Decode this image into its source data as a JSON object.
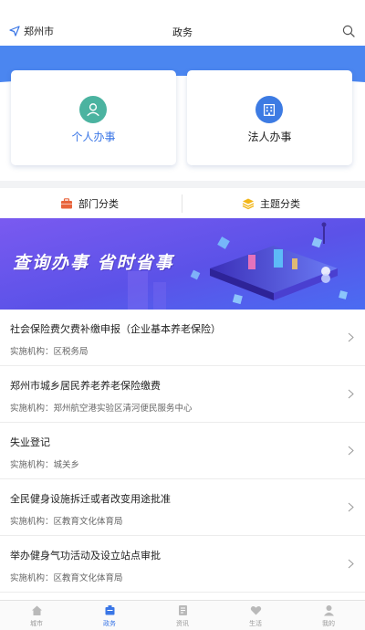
{
  "header": {
    "location": "郑州市",
    "title": "政务"
  },
  "cards": [
    {
      "label": "个人办事",
      "color": "#3a76e6",
      "icon_color": "#4bb3a0"
    },
    {
      "label": "法人办事",
      "color": "#222222",
      "icon_color": "#3d7be3"
    }
  ],
  "categories": [
    {
      "label": "部门分类"
    },
    {
      "label": "主题分类"
    }
  ],
  "banner": {
    "text": "查询办事  省时省事"
  },
  "services": [
    {
      "name": "社会保险费欠费补缴申报（企业基本养老保险）",
      "agency": "实施机构：区税务局"
    },
    {
      "name": "郑州市城乡居民养老养老保险缴费",
      "agency": "实施机构：郑州航空港实验区清河便民服务中心"
    },
    {
      "name": "失业登记",
      "agency": "实施机构：城关乡"
    },
    {
      "name": "全民健身设施拆迁或者改变用途批准",
      "agency": "实施机构：区教育文化体育局"
    },
    {
      "name": "举办健身气功活动及设立站点审批",
      "agency": "实施机构：区教育文化体育局"
    }
  ],
  "tabs": [
    {
      "label": "城市",
      "icon": "home-icon"
    },
    {
      "label": "政务",
      "icon": "government-icon"
    },
    {
      "label": "资讯",
      "icon": "news-icon"
    },
    {
      "label": "生活",
      "icon": "heart-icon"
    },
    {
      "label": "我的",
      "icon": "user-icon"
    }
  ],
  "colors": {
    "primary": "#3a76e6",
    "band": "#4b86f0"
  }
}
